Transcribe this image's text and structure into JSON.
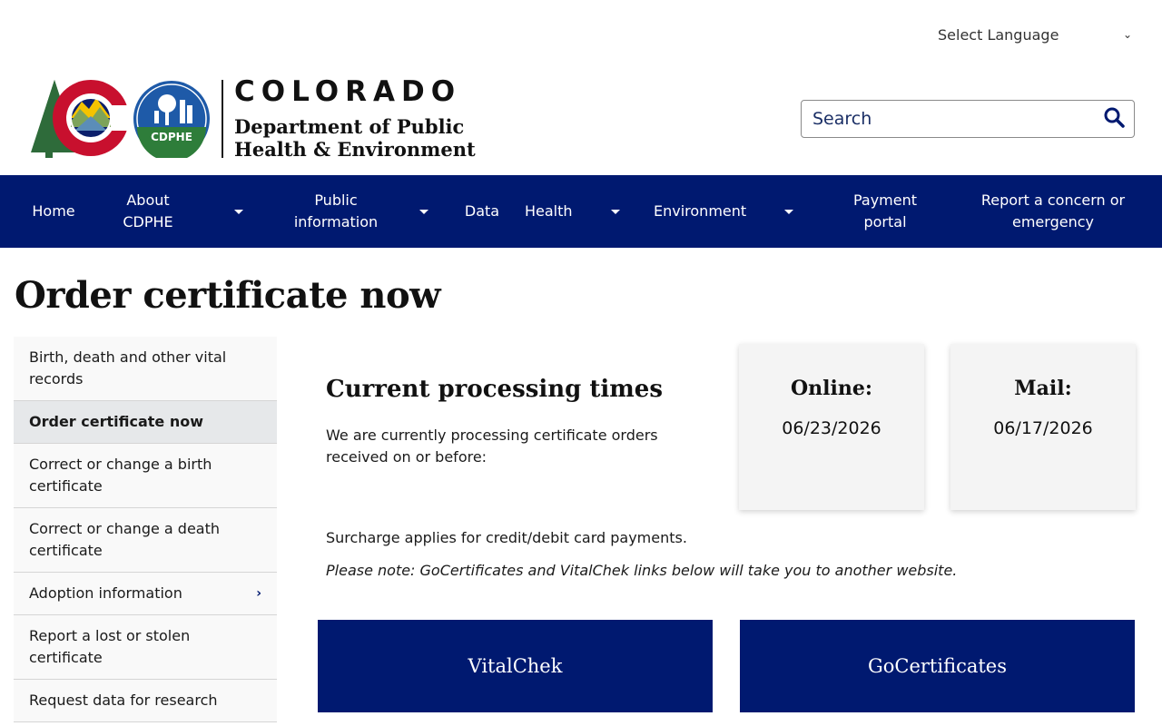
{
  "language": {
    "label": "Select Language"
  },
  "logo": {
    "state": "COLORADO",
    "dept_line1": "Department of Public",
    "dept_line2": "Health & Environment",
    "seal_text": "CDPHE"
  },
  "search": {
    "placeholder": "Search"
  },
  "nav": {
    "items": [
      {
        "label": "Home",
        "dropdown": false
      },
      {
        "label": "About CDPHE",
        "dropdown": true
      },
      {
        "label": "Public information",
        "dropdown": true
      },
      {
        "label": "Data",
        "dropdown": false
      },
      {
        "label": "Health",
        "dropdown": true
      },
      {
        "label": "Environment",
        "dropdown": true
      },
      {
        "label": "Payment portal",
        "dropdown": false
      },
      {
        "label": "Report a concern or emergency",
        "dropdown": false
      }
    ]
  },
  "page": {
    "title": "Order certificate now"
  },
  "sidebar": {
    "items": [
      {
        "label": "Birth, death and other vital records"
      },
      {
        "label": "Order certificate now"
      },
      {
        "label": "Correct or change a birth certificate"
      },
      {
        "label": "Correct or change a death certificate"
      },
      {
        "label": "Adoption information"
      },
      {
        "label": "Report a lost or stolen certificate"
      },
      {
        "label": "Request data for research"
      }
    ]
  },
  "processing": {
    "title": "Current processing times",
    "description": "We are currently processing certificate orders received on or before:",
    "online_label": "Online:",
    "online_date": "06/23/2026",
    "mail_label": "Mail:",
    "mail_date": "06/17/2026"
  },
  "notes": {
    "surcharge": "Surcharge applies for credit/debit card payments.",
    "external": "Please note: GoCertificates and VitalChek links below will take you to another website."
  },
  "buttons": {
    "vitalchek": "VitalChek",
    "gocertificates": "GoCertificates"
  },
  "colors": {
    "navy": "#001970",
    "card_bg": "#f4f4f4",
    "active_bg": "#e6e8ea"
  }
}
